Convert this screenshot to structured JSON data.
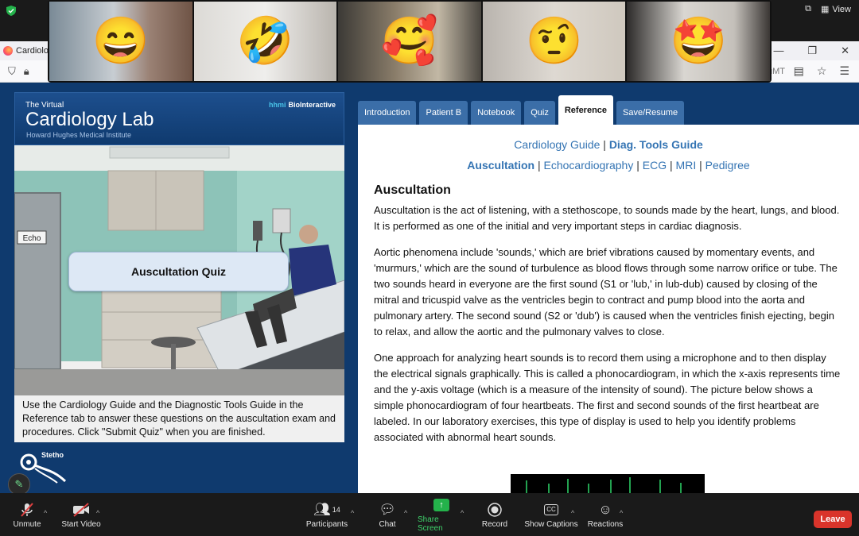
{
  "zoom": {
    "view_label": "View",
    "toolbar": {
      "unmute": "Unmute",
      "start_video": "Start Video",
      "participants": "Participants",
      "participants_count": "14",
      "chat": "Chat",
      "share_screen": "Share Screen",
      "record": "Record",
      "show_captions": "Show Captions",
      "reactions": "Reactions",
      "leave": "Leave"
    },
    "participants": [
      {
        "emoji": "😄"
      },
      {
        "emoji": "🤣"
      },
      {
        "emoji": "🥰"
      },
      {
        "emoji": "🤨"
      },
      {
        "emoji": "🤩"
      }
    ],
    "colors": {
      "share_green": "#24b24b",
      "leave_red": "#d9342b"
    }
  },
  "browser": {
    "tab_title": "Cardiolog",
    "url_fragment": "uMT"
  },
  "lab": {
    "subtitle": "The Virtual",
    "title": "Cardiology Lab",
    "org": "Howard Hughes Medical Institute",
    "brand_hhmi": "hhmi",
    "brand_name": "BioInteractive",
    "quiz_button": "Auscultation Quiz",
    "echo_sign": "Echo",
    "instructions": "Use the Cardiology Guide and the Diagnostic Tools Guide in the Reference tab to answer these questions on the auscultation exam and procedures. Click \"Submit Quiz\" when you are finished.",
    "tool_label": "Stetho"
  },
  "tabs": [
    {
      "label": "Introduction"
    },
    {
      "label": "Patient B"
    },
    {
      "label": "Notebook"
    },
    {
      "label": "Quiz"
    },
    {
      "label": "Reference"
    },
    {
      "label": "Save/Resume"
    }
  ],
  "reference": {
    "guide_links": {
      "cardiology": "Cardiology Guide",
      "sep": "|",
      "diag": "Diag. Tools Guide"
    },
    "subnav": [
      "Auscultation",
      "Echocardiography",
      "ECG",
      "MRI",
      "Pedigree"
    ],
    "heading": "Auscultation",
    "paragraphs": [
      "Auscultation is the act of listening, with a stethoscope, to sounds made by the heart, lungs, and blood. It is performed as one of the initial and very important steps in cardiac diagnosis.",
      "Aortic phenomena include 'sounds,' which are brief vibrations caused by momentary events, and 'murmurs,' which are the sound of turbulence as blood flows through some narrow orifice or tube. The two sounds heard in everyone are the first sound (S1 or 'lub,' in lub-dub) caused by closing of the mitral and tricuspid valve as the ventricles begin to contract and pump blood into the aorta and pulmonary artery. The second sound (S2 or 'dub') is caused when the ventricles finish ejecting, begin to relax, and allow the aortic and the pulmonary valves to close.",
      "One approach for analyzing heart sounds is to record them using a microphone and to then display the electrical signals graphically. This is called a phonocardiogram, in which the x-axis represents time and the y-axis voltage (which is a measure of the intensity of sound). The picture below shows a simple phonocardiogram of four heartbeats. The first and second sounds of the first heartbeat are labeled. In our laboratory exercises, this type of display is used to help you identify problems associated with abnormal heart sounds."
    ]
  }
}
